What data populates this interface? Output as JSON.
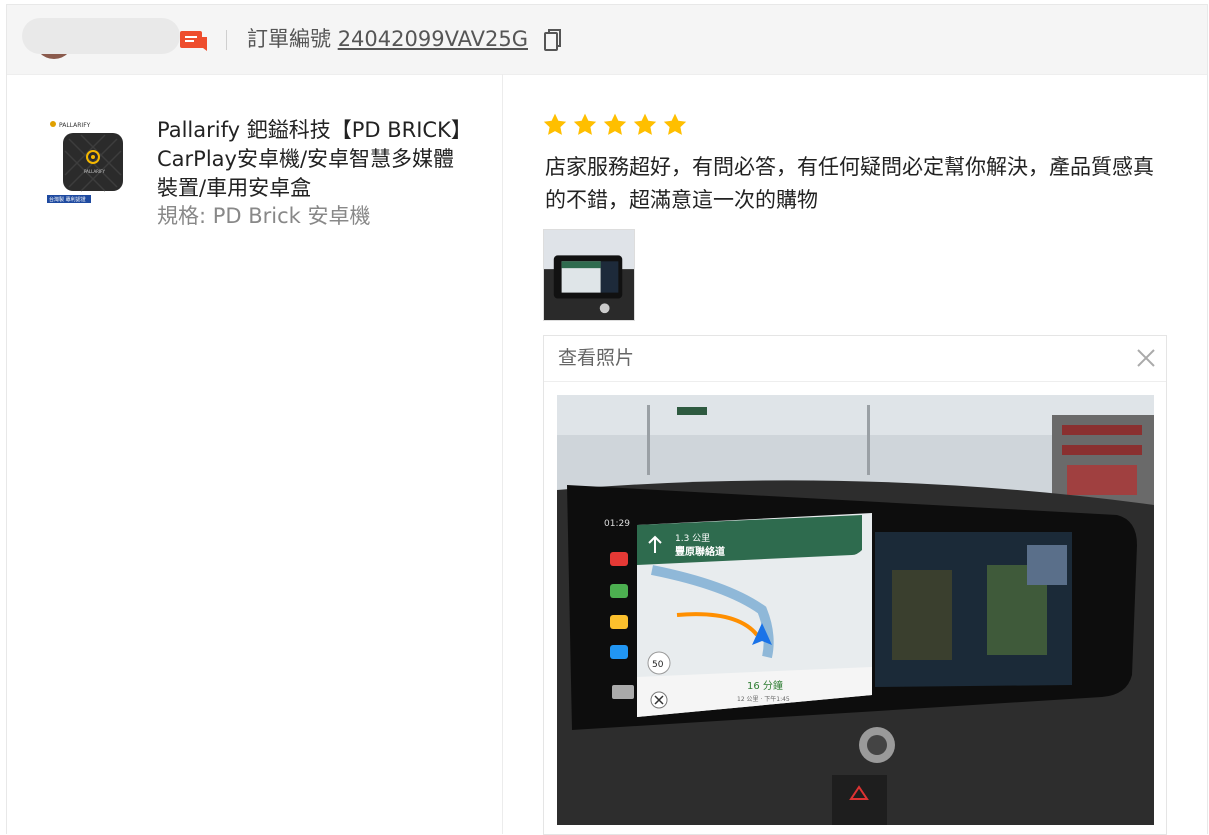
{
  "header": {
    "order_label": "訂單編號",
    "order_number": "24042099VAV25G"
  },
  "product": {
    "name": "Pallarify 鈀鎰科技【PD BRICK】CarPlay安卓機/安卓智慧多媒體裝置/車用安卓盒",
    "variant": "規格: PD Brick 安卓機"
  },
  "review": {
    "rating": 5,
    "text": "店家服務超好，有問必答，有任何疑問必定幫你解決，產品質感真的不錯，超滿意這一次的購物"
  },
  "photo_viewer": {
    "title": "查看照片"
  },
  "screen": {
    "time": "01:29",
    "distance": "1.3 公里",
    "road": "豐原聯絡道",
    "speed": "50",
    "eta": "16 分鐘",
    "eta_detail": "12 公里 · 下午1:45"
  },
  "colors": {
    "star": "#ffbf00",
    "chat_icon": "#ee4d2d",
    "nav_green": "#2e6b4e"
  }
}
